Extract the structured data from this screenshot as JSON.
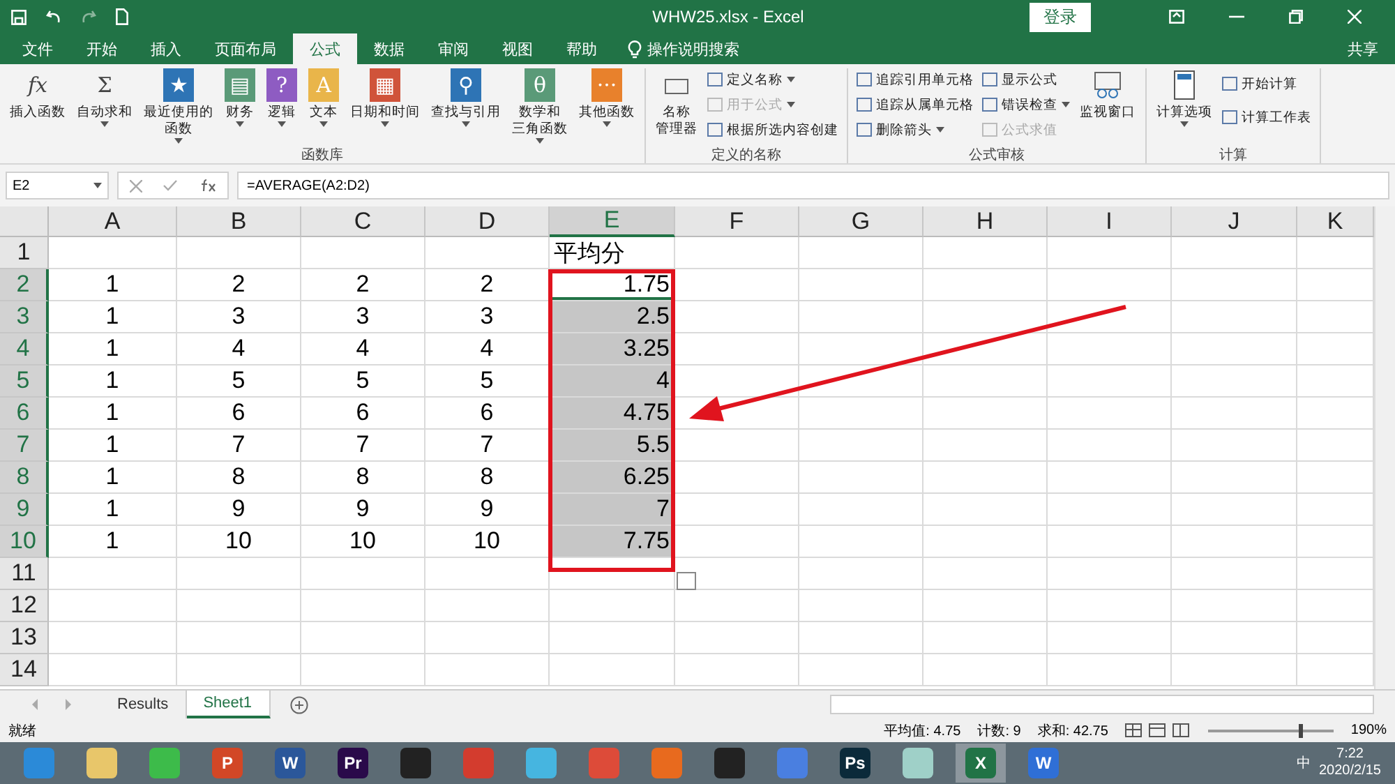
{
  "window": {
    "title": "WHW25.xlsx  -  Excel",
    "login": "登录",
    "share": "共享"
  },
  "tabs": [
    {
      "label": "文件",
      "selected": false
    },
    {
      "label": "开始",
      "selected": false
    },
    {
      "label": "插入",
      "selected": false
    },
    {
      "label": "页面布局",
      "selected": false
    },
    {
      "label": "公式",
      "selected": true
    },
    {
      "label": "数据",
      "selected": false
    },
    {
      "label": "审阅",
      "selected": false
    },
    {
      "label": "视图",
      "selected": false
    },
    {
      "label": "帮助",
      "selected": false
    }
  ],
  "tell_me": "操作说明搜索",
  "ribbon": {
    "function_library": {
      "title": "函数库",
      "buttons": [
        {
          "label": "插入函数",
          "glyph": "fx",
          "color": "#444444",
          "dropdown": false
        },
        {
          "label": "自动求和",
          "glyph": "Σ",
          "color": "#444444",
          "dropdown": true
        },
        {
          "label": "最近使用的",
          "label2": "函数",
          "glyph": "★",
          "color": "#2e74b5",
          "dropdown": true
        },
        {
          "label": "财务",
          "glyph": "▤",
          "color": "#5a9a78",
          "dropdown": true
        },
        {
          "label": "逻辑",
          "glyph": "?",
          "color": "#8e5cc2",
          "dropdown": true
        },
        {
          "label": "文本",
          "glyph": "A",
          "color": "#e9b54a",
          "dropdown": true
        },
        {
          "label": "日期和时间",
          "glyph": "▦",
          "color": "#d0533a",
          "dropdown": true
        },
        {
          "label": "查找与引用",
          "glyph": "⚲",
          "color": "#2e74b5",
          "dropdown": true
        },
        {
          "label": "数学和",
          "label2": "三角函数",
          "glyph": "θ",
          "color": "#5a9a78",
          "dropdown": true
        },
        {
          "label": "其他函数",
          "glyph": "···",
          "color": "#e8812c",
          "dropdown": true
        }
      ]
    },
    "defined_names": {
      "title": "定义的名称",
      "big": "名称",
      "big2": "管理器",
      "items": [
        {
          "label": "定义名称",
          "dropdown": true,
          "disabled": false
        },
        {
          "label": "用于公式",
          "dropdown": true,
          "disabled": true
        },
        {
          "label": "根据所选内容创建",
          "dropdown": false,
          "disabled": false
        }
      ]
    },
    "formula_auditing": {
      "title": "公式审核",
      "items": [
        {
          "label": "追踪引用单元格",
          "dropdown": false,
          "disabled": false
        },
        {
          "label": "追踪从属单元格",
          "dropdown": false,
          "disabled": false
        },
        {
          "label": "删除箭头",
          "dropdown": true,
          "disabled": false
        },
        {
          "label": "显示公式",
          "dropdown": false,
          "disabled": false
        },
        {
          "label": "错误检查",
          "dropdown": true,
          "disabled": false
        },
        {
          "label": "公式求值",
          "dropdown": false,
          "disabled": true
        }
      ],
      "watch": "监视窗口"
    },
    "calculation": {
      "title": "计算",
      "options": "计算选项",
      "items": [
        {
          "label": "开始计算"
        },
        {
          "label": "计算工作表"
        }
      ]
    }
  },
  "formula_bar": {
    "name_box": "E2",
    "formula": "=AVERAGE(A2:D2)"
  },
  "columns": [
    {
      "label": "A",
      "selected": false
    },
    {
      "label": "B",
      "selected": false
    },
    {
      "label": "C",
      "selected": false
    },
    {
      "label": "D",
      "selected": false
    },
    {
      "label": "E",
      "selected": true
    },
    {
      "label": "F",
      "selected": false
    },
    {
      "label": "G",
      "selected": false
    },
    {
      "label": "H",
      "selected": false
    },
    {
      "label": "I",
      "selected": false
    },
    {
      "label": "J",
      "selected": false
    },
    {
      "label": "K",
      "selected": false
    }
  ],
  "rows": [
    {
      "header": "1",
      "selected": false,
      "active": false,
      "e": "平均分"
    },
    {
      "header": "2",
      "selected": true,
      "active": true,
      "a": "1",
      "b": "2",
      "c": "2",
      "d": "2",
      "e": "1.75"
    },
    {
      "header": "3",
      "selected": true,
      "active": false,
      "a": "1",
      "b": "3",
      "c": "3",
      "d": "3",
      "e": "2.5"
    },
    {
      "header": "4",
      "selected": true,
      "active": false,
      "a": "1",
      "b": "4",
      "c": "4",
      "d": "4",
      "e": "3.25"
    },
    {
      "header": "5",
      "selected": true,
      "active": false,
      "a": "1",
      "b": "5",
      "c": "5",
      "d": "5",
      "e": "4"
    },
    {
      "header": "6",
      "selected": true,
      "active": false,
      "a": "1",
      "b": "6",
      "c": "6",
      "d": "6",
      "e": "4.75"
    },
    {
      "header": "7",
      "selected": true,
      "active": false,
      "a": "1",
      "b": "7",
      "c": "7",
      "d": "7",
      "e": "5.5"
    },
    {
      "header": "8",
      "selected": true,
      "active": false,
      "a": "1",
      "b": "8",
      "c": "8",
      "d": "8",
      "e": "6.25"
    },
    {
      "header": "9",
      "selected": true,
      "active": false,
      "a": "1",
      "b": "9",
      "c": "9",
      "d": "9",
      "e": "7"
    },
    {
      "header": "10",
      "selected": true,
      "active": false,
      "a": "1",
      "b": "10",
      "c": "10",
      "d": "10",
      "e": "7.75"
    },
    {
      "header": "11",
      "selected": false,
      "active": false
    },
    {
      "header": "12",
      "selected": false,
      "active": false
    },
    {
      "header": "13",
      "selected": false,
      "active": false
    },
    {
      "header": "14",
      "selected": false,
      "active": false
    }
  ],
  "sheets": [
    {
      "label": "Results",
      "selected": false
    },
    {
      "label": "Sheet1",
      "selected": true
    }
  ],
  "status_bar": {
    "ready": "就绪",
    "average": "平均值: 4.75",
    "count": "计数: 9",
    "sum": "求和: 42.75",
    "zoom": "190%",
    "zoom_slider": {
      "level": 0.72
    }
  },
  "taskbar": [
    {
      "color": "#2b8ad8",
      "selected": false
    },
    {
      "color": "#e8c66a",
      "selected": false
    },
    {
      "color": "#3dbb4a",
      "selected": false
    },
    {
      "color": "#d24726",
      "glyph": "P",
      "selected": false
    },
    {
      "color": "#2b579a",
      "glyph": "W",
      "selected": false
    },
    {
      "color": "#2a0a4a",
      "glyph": "Pr",
      "selected": false
    },
    {
      "color": "#222222",
      "selected": false
    },
    {
      "color": "#d33c2e",
      "selected": false
    },
    {
      "color": "#46b5e0",
      "selected": false
    },
    {
      "color": "#dd4b39",
      "selected": false
    },
    {
      "color": "#e86a1e",
      "selected": false
    },
    {
      "color": "#222222",
      "selected": false
    },
    {
      "color": "#4a7fe0",
      "selected": false
    },
    {
      "color": "#0b2a3a",
      "glyph": "Ps",
      "selected": false
    },
    {
      "color": "#9fd0c8",
      "selected": false
    },
    {
      "color": "#217346",
      "glyph": "X",
      "selected": true
    },
    {
      "color": "#2f6fd6",
      "glyph": "W",
      "selected": false
    }
  ],
  "tray": {
    "ime": "中",
    "time": "7:22",
    "date": "2020/2/15"
  }
}
